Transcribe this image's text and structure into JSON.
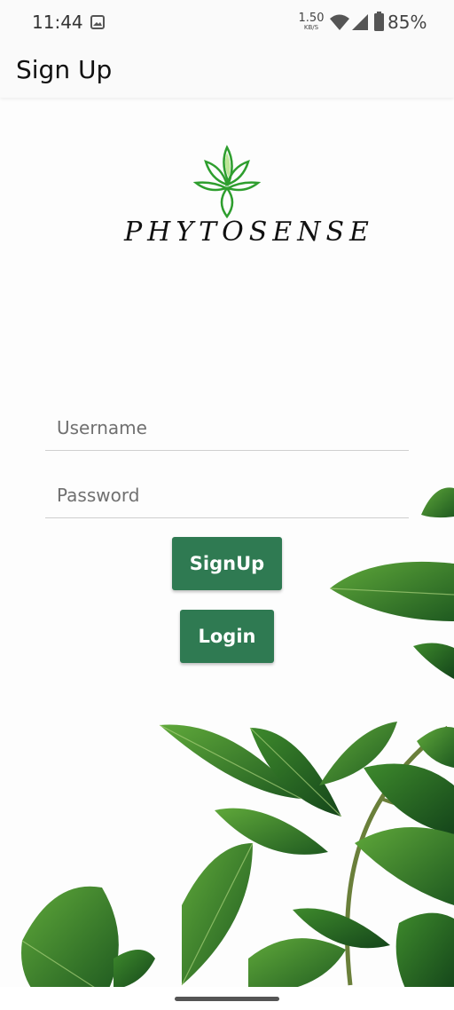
{
  "status_bar": {
    "time": "11:44",
    "net_speed_value": "1.50",
    "net_speed_unit": "KB/S",
    "battery": "85%",
    "icons": [
      "gallery-icon",
      "wifi-icon",
      "cell-signal-icon",
      "battery-icon"
    ]
  },
  "app_bar": {
    "title": "Sign Up"
  },
  "logo": {
    "text": "PHYTOSENSE",
    "icon": "cannabis-leaf-drop-icon",
    "colors": [
      "#2e9e2e",
      "#7ccf2f"
    ]
  },
  "form": {
    "username_placeholder": "Username",
    "username_value": "",
    "password_placeholder": "Password",
    "password_value": "",
    "signup_label": "SignUp",
    "login_label": "Login"
  },
  "colors": {
    "button": "#2f7a52",
    "button_text": "#ffffff",
    "background": "#fdfdfd"
  }
}
